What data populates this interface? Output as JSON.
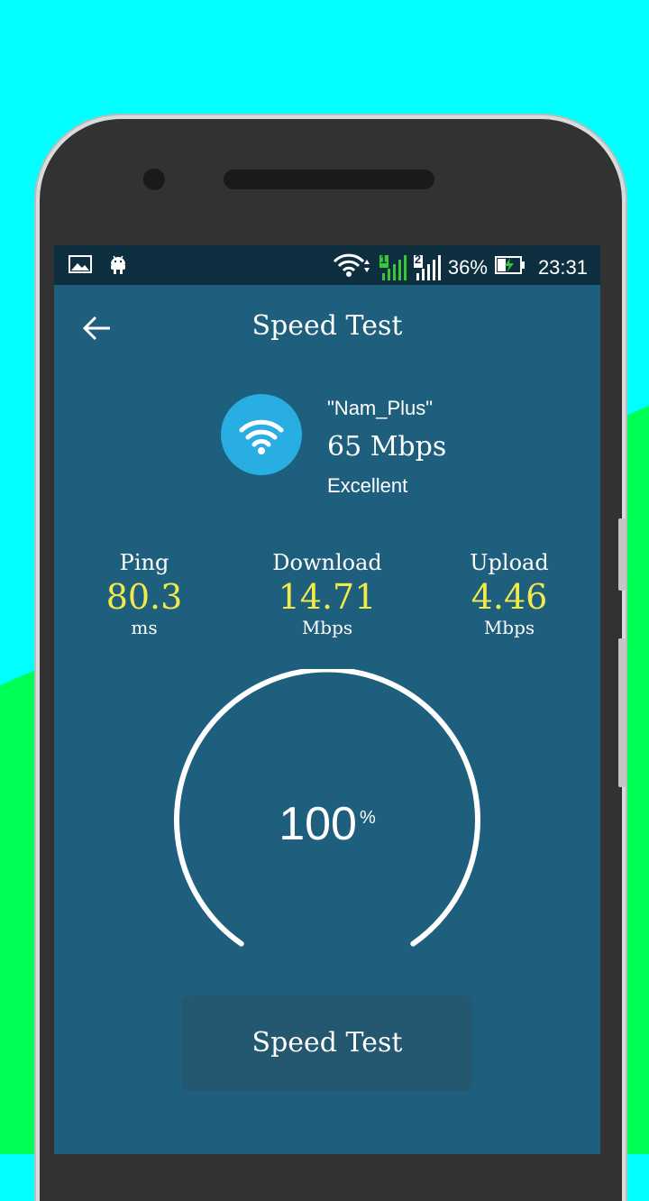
{
  "statusbar": {
    "battery_percent": "36%",
    "time": "23:31",
    "sim1_label": "1",
    "sim2_label": "2",
    "icons": [
      "gallery-icon",
      "android-icon",
      "wifi-icon",
      "signal-icon",
      "battery-charging-icon"
    ]
  },
  "appbar": {
    "title": "Speed Test"
  },
  "network": {
    "name": "\"Nam_Plus\"",
    "speed": "65 Mbps",
    "quality": "Excellent"
  },
  "metrics": {
    "ping": {
      "label": "Ping",
      "value": "80.3",
      "unit": "ms"
    },
    "download": {
      "label": "Download",
      "value": "14.71",
      "unit": "Mbps"
    },
    "upload": {
      "label": "Upload",
      "value": "4.46",
      "unit": "Mbps"
    }
  },
  "gauge": {
    "value": "100",
    "unit": "%",
    "progress": 1.0
  },
  "action_button": {
    "label": "Speed Test"
  },
  "colors": {
    "screen_bg": "#1e5f7e",
    "accent_value": "#f2e94a",
    "wifi_badge": "#29aee3",
    "button_bg": "#245870"
  }
}
